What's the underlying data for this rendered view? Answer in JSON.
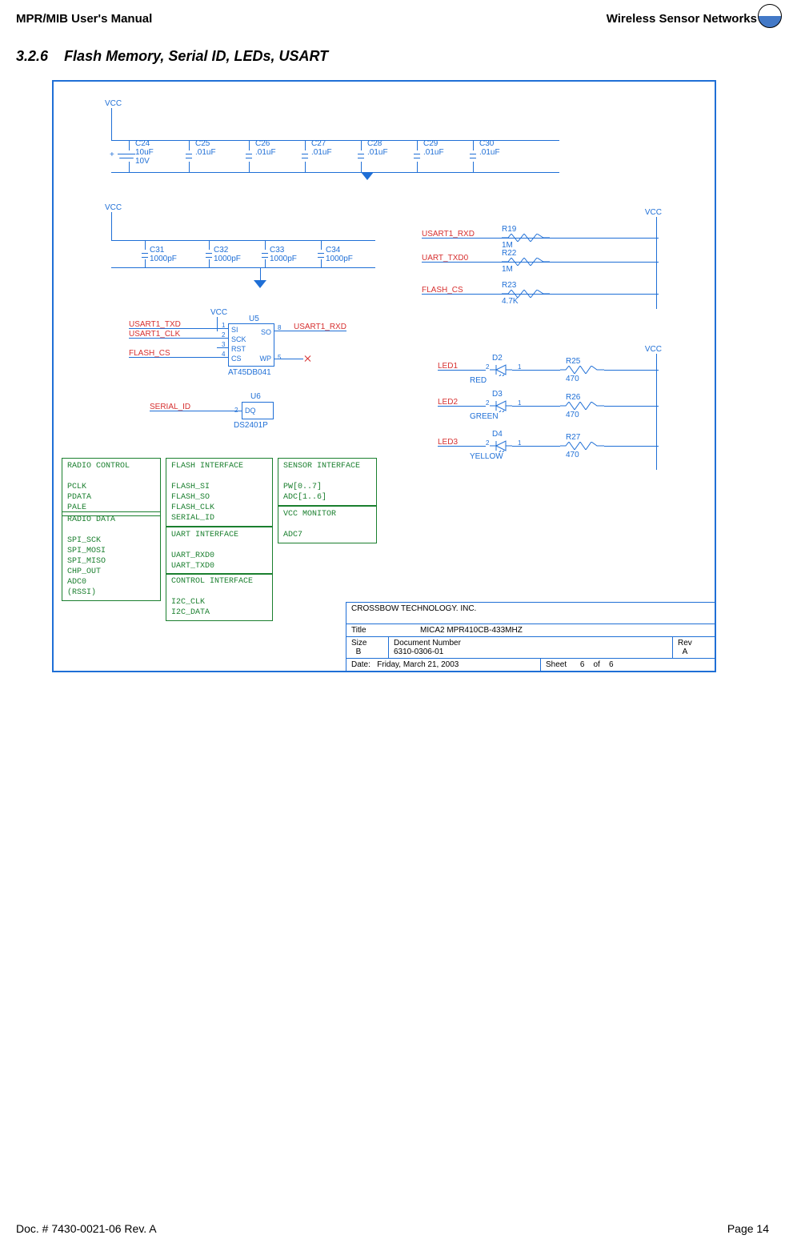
{
  "doc": {
    "header_left": "MPR/MIB User's Manual",
    "header_right": "Wireless Sensor Networks",
    "section_no": "3.2.6",
    "section_title": "Flash Memory, Serial ID, LEDs, USART",
    "footer_left": "Doc. # 7430-0021-06 Rev. A",
    "footer_right": "Page 14"
  },
  "rails": {
    "vcc": "VCC"
  },
  "caps_top": [
    {
      "ref": "C24",
      "val": "10uF",
      "volt": "10V"
    },
    {
      "ref": "C25",
      "val": ".01uF"
    },
    {
      "ref": "C26",
      "val": ".01uF"
    },
    {
      "ref": "C27",
      "val": ".01uF"
    },
    {
      "ref": "C28",
      "val": ".01uF"
    },
    {
      "ref": "C29",
      "val": ".01uF"
    },
    {
      "ref": "C30",
      "val": ".01uF"
    }
  ],
  "caps_row2": [
    {
      "ref": "C31",
      "val": "1000pF"
    },
    {
      "ref": "C32",
      "val": "1000pF"
    },
    {
      "ref": "C33",
      "val": "1000pF"
    },
    {
      "ref": "C34",
      "val": "1000pF"
    }
  ],
  "u5": {
    "ref": "U5",
    "part": "AT45DB041",
    "pins_left": [
      "SI",
      "SCK",
      "RST",
      "CS"
    ],
    "pins_right": [
      "SO",
      "WP"
    ],
    "pinnums_left": [
      "1",
      "2",
      "3",
      "4"
    ],
    "pinnums_right": [
      "8",
      "5"
    ]
  },
  "u5_nets": {
    "si": "USART1_TXD",
    "sck": "USART1_CLK",
    "rst": "",
    "cs": "FLASH_CS",
    "so": "USART1_RXD"
  },
  "u6": {
    "ref": "U6",
    "part": "DS2401P",
    "pin": "DQ",
    "pinnum": "2"
  },
  "u6_net": "SERIAL_ID",
  "pullups": [
    {
      "ref": "R19",
      "val": "1M",
      "net": "USART1_RXD"
    },
    {
      "ref": "R22",
      "val": "1M",
      "net": "UART_TXD0"
    },
    {
      "ref": "R23",
      "val": "4.7K",
      "net": "FLASH_CS"
    }
  ],
  "leds": [
    {
      "net": "LED1",
      "diode": "D2",
      "color": "RED",
      "res": "R25",
      "rval": "470"
    },
    {
      "net": "LED2",
      "diode": "D3",
      "color": "GREEN",
      "res": "R26",
      "rval": "470"
    },
    {
      "net": "LED3",
      "diode": "D4",
      "color": "YELLOW",
      "res": "R27",
      "rval": "470"
    }
  ],
  "boxes": {
    "radio_control": {
      "title": "RADIO CONTROL",
      "lines": [
        "PCLK",
        "PDATA",
        "PALE"
      ]
    },
    "radio_data": {
      "title": "RADIO DATA",
      "lines": [
        "SPI_SCK",
        "SPI_MOSI",
        "SPI_MISO",
        "CHP_OUT",
        "ADC0",
        "(RSSI)"
      ]
    },
    "flash_iface": {
      "title": "FLASH INTERFACE",
      "lines": [
        "FLASH_SI",
        "FLASH_SO",
        "FLASH_CLK",
        "SERIAL_ID"
      ]
    },
    "uart_iface": {
      "title": "UART INTERFACE",
      "lines": [
        "UART_RXD0",
        "UART_TXD0"
      ]
    },
    "ctrl_iface": {
      "title": "CONTROL INTERFACE",
      "lines": [
        "I2C_CLK",
        "I2C_DATA"
      ]
    },
    "sensor_iface": {
      "title": "SENSOR INTERFACE",
      "lines": [
        "PW[0..7]",
        "ADC[1..6]"
      ]
    },
    "vcc_mon": {
      "title": "VCC MONITOR",
      "lines": [
        "ADC7"
      ]
    }
  },
  "titleblock": {
    "company": "CROSSBOW TECHNOLOGY. INC.",
    "title_lbl": "Title",
    "title": "MICA2 MPR410CB-433MHZ",
    "size_lbl": "Size",
    "size": "B",
    "docnum_lbl": "Document Number",
    "docnum": "6310-0306-01",
    "rev_lbl": "Rev",
    "rev": "A",
    "date_lbl": "Date:",
    "date": "Friday, March 21, 2003",
    "sheet_lbl": "Sheet",
    "sheet_cur": "6",
    "of": "of",
    "sheet_tot": "6"
  }
}
